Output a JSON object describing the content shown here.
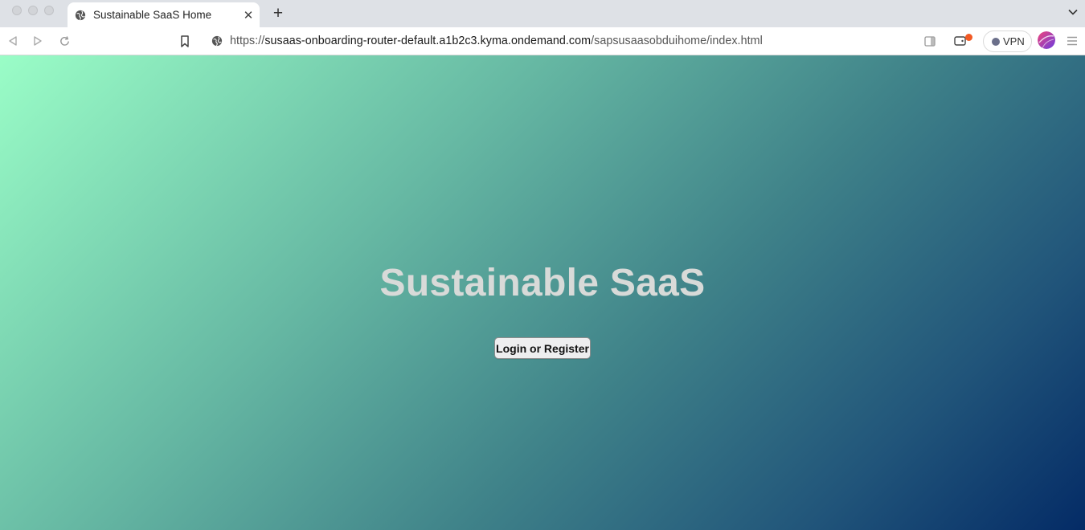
{
  "browser": {
    "tab": {
      "title": "Sustainable SaaS Home",
      "close_glyph": "✕"
    },
    "new_tab_glyph": "+",
    "url": {
      "scheme": "https://",
      "host": "susaas-onboarding-router-default.a1b2c3.kyma.ondemand.com",
      "path": "/sapsusaasobduihome/index.html"
    },
    "vpn_label": "VPN",
    "icons": [
      "back-icon",
      "forward-icon",
      "reload-icon",
      "bookmark-icon",
      "site-info-icon",
      "sidebar-icon",
      "wallet-icon",
      "profile-avatar",
      "menu-icon"
    ],
    "colors": {
      "wallet_badge": "#f25a24"
    }
  },
  "page": {
    "title": "Sustainable SaaS",
    "cta_label": "Login or Register",
    "colors": {
      "gradient_start": "#9afdc7",
      "gradient_end": "#042b66",
      "title_text": "#d8dad8"
    }
  }
}
